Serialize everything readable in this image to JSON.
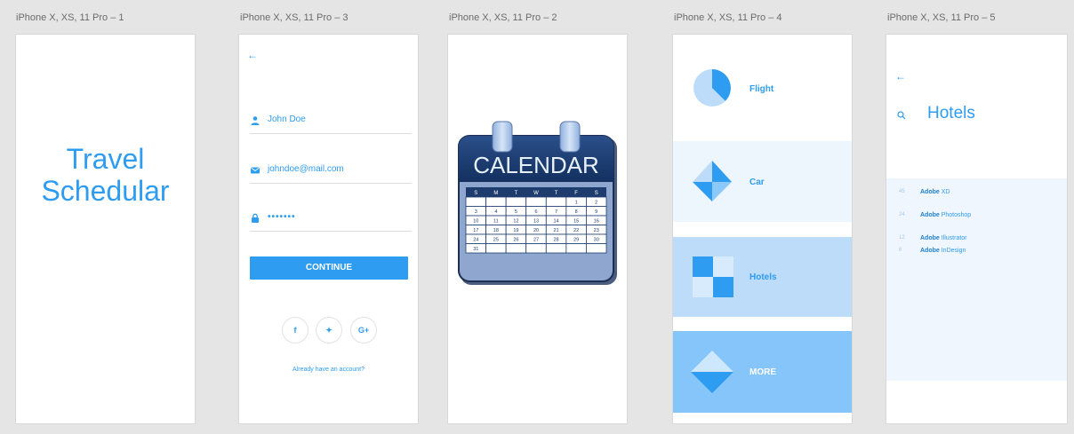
{
  "artboards": [
    {
      "label": "iPhone X, XS, 11 Pro – 1"
    },
    {
      "label": "iPhone X, XS, 11 Pro – 3"
    },
    {
      "label": "iPhone X, XS, 11 Pro – 2"
    },
    {
      "label": "iPhone X, XS, 11 Pro – 4"
    },
    {
      "label": "iPhone X, XS, 11 Pro – 5"
    }
  ],
  "splash": {
    "line1": "Travel",
    "line2": "Schedular"
  },
  "signup": {
    "name": "John Doe",
    "email": "johndoe@mail.com",
    "password": "•••••••",
    "continue_label": "CONTINUE",
    "social": {
      "facebook": "f",
      "twitter": "✦",
      "google": "G+"
    },
    "account_link": "Already have an account?"
  },
  "calendar": {
    "title": "CALENDAR",
    "weekdays": [
      "S",
      "M",
      "T",
      "W",
      "T",
      "F",
      "S"
    ],
    "weeks": [
      [
        "",
        "",
        "",
        "",
        "",
        "1",
        "2"
      ],
      [
        "3",
        "4",
        "5",
        "6",
        "7",
        "8",
        "9"
      ],
      [
        "10",
        "11",
        "12",
        "13",
        "14",
        "15",
        "16"
      ],
      [
        "17",
        "18",
        "19",
        "20",
        "21",
        "22",
        "23"
      ],
      [
        "24",
        "25",
        "26",
        "27",
        "28",
        "29",
        "30"
      ],
      [
        "31",
        "",
        "",
        "",
        "",
        "",
        ""
      ]
    ]
  },
  "menu": {
    "flight": "Flight",
    "car": "Car",
    "hotels": "Hotels",
    "more": "MORE"
  },
  "hotels": {
    "title": "Hotels",
    "list": [
      {
        "num": "45",
        "brand": "Adobe",
        "product": " XD"
      },
      {
        "num": "24",
        "brand": "Adobe",
        "product": " Photoshop"
      },
      {
        "num": "12",
        "brand": "Adobe",
        "product": " Illustrator"
      },
      {
        "num": "6",
        "brand": "Adobe",
        "product": " InDesign"
      }
    ]
  },
  "colors": {
    "accent": "#2e9cf0",
    "light": "#eef6fd",
    "mid": "#bcdcfa",
    "strong": "#86c5f9"
  }
}
